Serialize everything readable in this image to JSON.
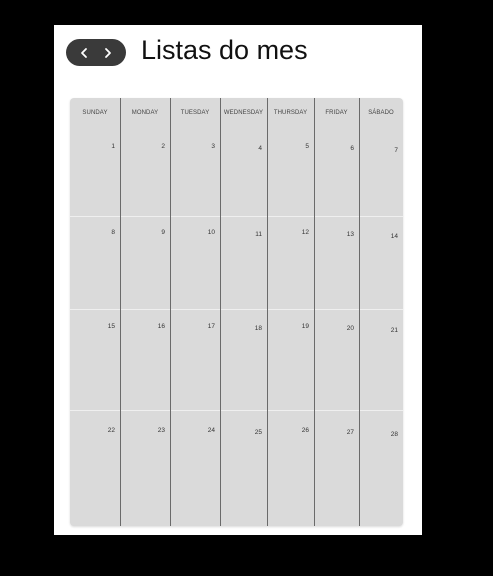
{
  "header": {
    "title": "Listas do mes",
    "prev_icon": "chevron-left-icon",
    "next_icon": "chevron-right-icon"
  },
  "calendar": {
    "days": [
      "SUNDAY",
      "MONDAY",
      "TUESDAY",
      "WEDNESDAY",
      "THURSDAY",
      "FRIDAY",
      "SÁBADO"
    ],
    "weeks": [
      [
        "1",
        "2",
        "3",
        "4",
        "5",
        "6",
        "7"
      ],
      [
        "8",
        "9",
        "10",
        "11",
        "12",
        "13",
        "14"
      ],
      [
        "15",
        "16",
        "17",
        "18",
        "19",
        "20",
        "21"
      ],
      [
        "22",
        "23",
        "24",
        "25",
        "26",
        "27",
        "28"
      ]
    ]
  },
  "colors": {
    "background": "#000000",
    "card": "#ffffff",
    "calendar": "#dadada",
    "nav_pill": "#3a3a3a"
  }
}
